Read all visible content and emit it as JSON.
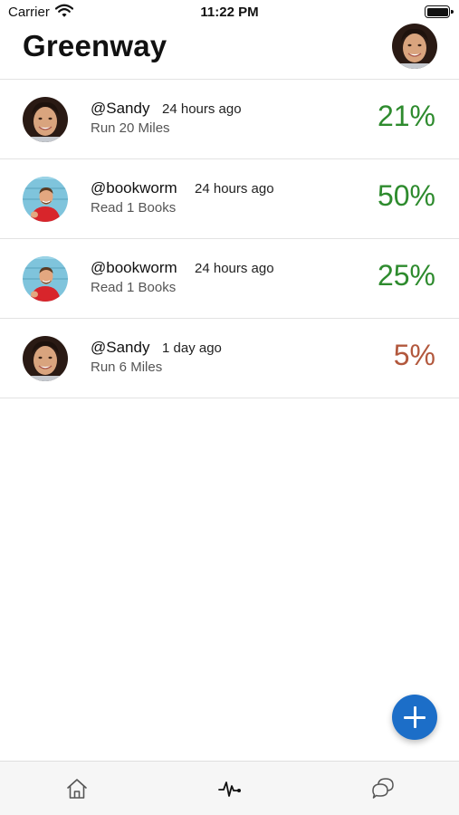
{
  "status_bar": {
    "carrier": "Carrier",
    "time": "11:22 PM"
  },
  "header": {
    "title": "Greenway",
    "avatar_icon": "user-avatar-sandy"
  },
  "feed": [
    {
      "username": "@Sandy",
      "time": "24 hours ago",
      "goal": "Run 20 Miles",
      "percent": "21%",
      "percent_color": "#2e8b2e",
      "avatar": "sandy"
    },
    {
      "username": "@bookworm",
      "time": "24 hours ago",
      "goal": "Read 1 Books",
      "percent": "50%",
      "percent_color": "#2e8b2e",
      "avatar": "bookworm"
    },
    {
      "username": "@bookworm",
      "time": "24 hours ago",
      "goal": "Read 1 Books",
      "percent": "25%",
      "percent_color": "#2e8b2e",
      "avatar": "bookworm"
    },
    {
      "username": "@Sandy",
      "time": "1 day ago",
      "goal": "Run 6 Miles",
      "percent": "5%",
      "percent_color": "#b2583d",
      "avatar": "sandy"
    }
  ],
  "fab": {
    "icon": "plus-icon",
    "color": "#1c6ec8"
  },
  "tab_bar": {
    "tabs": [
      {
        "icon": "home-icon"
      },
      {
        "icon": "activity-icon"
      },
      {
        "icon": "chat-bubbles-icon"
      }
    ]
  },
  "colors": {
    "success": "#2e8b2e",
    "low": "#b2583d",
    "divider": "#e2e2e2"
  }
}
